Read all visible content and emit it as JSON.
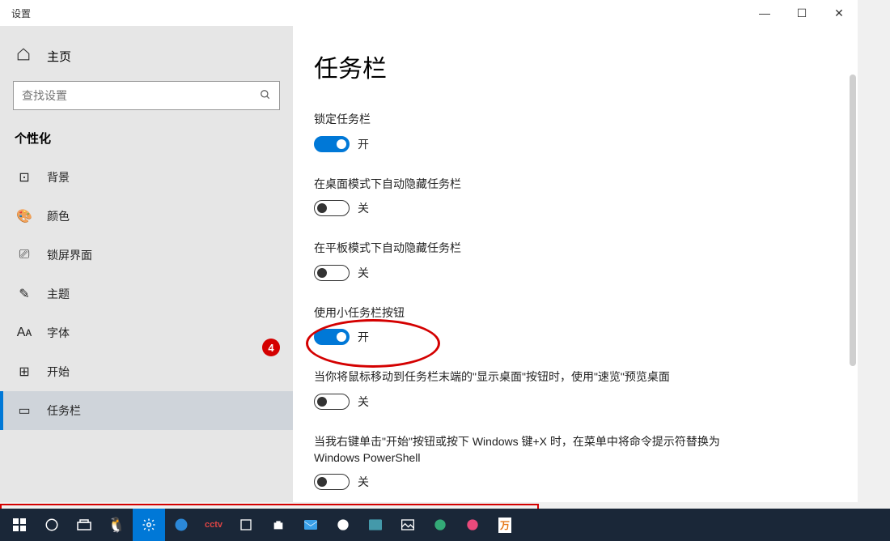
{
  "window": {
    "title": "设置"
  },
  "titlebar": {
    "minimize": "—",
    "maximize": "☐",
    "close": "✕"
  },
  "sidebar": {
    "home": "主页",
    "search_placeholder": "查找设置",
    "section": "个性化",
    "items": [
      {
        "icon": "⊡",
        "label": "背景"
      },
      {
        "icon": "🎨",
        "label": "颜色"
      },
      {
        "icon": "⎚",
        "label": "锁屏界面"
      },
      {
        "icon": "✎",
        "label": "主题"
      },
      {
        "icon": "Aᴀ",
        "label": "字体"
      },
      {
        "icon": "⊞",
        "label": "开始"
      },
      {
        "icon": "▭",
        "label": "任务栏"
      }
    ],
    "selected_index": 6
  },
  "main": {
    "heading": "任务栏",
    "settings": [
      {
        "label": "锁定任务栏",
        "on": true,
        "state_text": "开"
      },
      {
        "label": "在桌面模式下自动隐藏任务栏",
        "on": false,
        "state_text": "关"
      },
      {
        "label": "在平板模式下自动隐藏任务栏",
        "on": false,
        "state_text": "关"
      },
      {
        "label": "使用小任务栏按钮",
        "on": true,
        "state_text": "开"
      },
      {
        "label": "当你将鼠标移动到任务栏末端的\"显示桌面\"按钮时，使用\"速览\"预览桌面",
        "on": false,
        "state_text": "关"
      },
      {
        "label": "当我右键单击\"开始\"按钮或按下 Windows 键+X 时，在菜单中将命令提示符替换为 Windows PowerShell",
        "on": false,
        "state_text": "关"
      }
    ]
  },
  "annotation": {
    "number": "4"
  },
  "taskbar_icons": [
    "start",
    "cortana",
    "taskview",
    "qq",
    "settings",
    "edge",
    "cctv",
    "snip",
    "store",
    "mail",
    "wps",
    "photos",
    "gallery",
    "3d",
    "todesk",
    "wanfang"
  ]
}
